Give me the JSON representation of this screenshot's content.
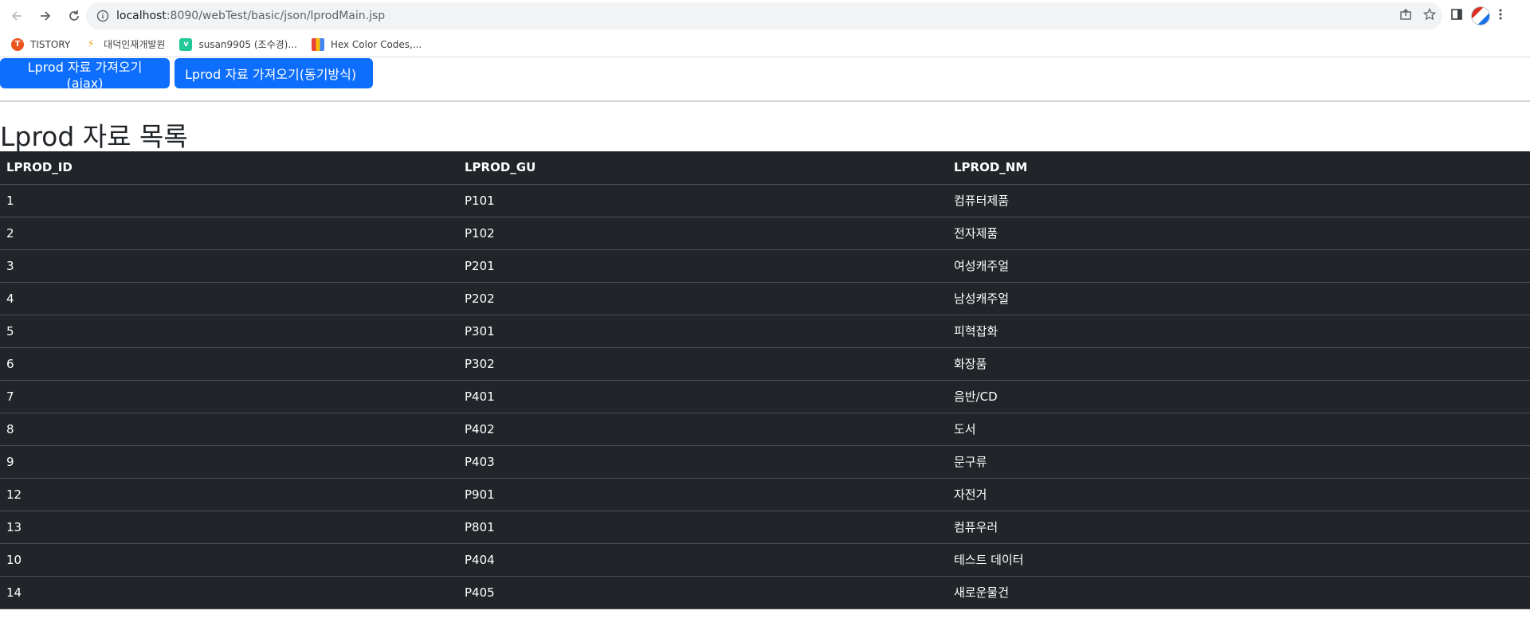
{
  "browser": {
    "url_host": "localhost",
    "url_rest": ":8090/webTest/basic/json/lprodMain.jsp",
    "bookmarks": [
      {
        "label": "TISTORY",
        "icon": "tistory-icon",
        "color": "#eb531f"
      },
      {
        "label": "대덕인재개발원",
        "icon": "ddit-icon",
        "color": "#f5a623"
      },
      {
        "label": "susan9905 (조수경)...",
        "icon": "velog-icon",
        "color": "#20c997"
      },
      {
        "label": "Hex Color Codes,...",
        "icon": "color-palette-icon",
        "color": "#4285f4"
      }
    ]
  },
  "page": {
    "buttons": {
      "ajax": "Lprod 자료 가져오기(ajax)",
      "sync": "Lprod 자료 가져오기(동기방식)"
    },
    "title": "Lprod 자료 목록",
    "table": {
      "headers": [
        "LPROD_ID",
        "LPROD_GU",
        "LPROD_NM"
      ],
      "rows": [
        [
          "1",
          "P101",
          "컴퓨터제품"
        ],
        [
          "2",
          "P102",
          "전자제품"
        ],
        [
          "3",
          "P201",
          "여성캐주얼"
        ],
        [
          "4",
          "P202",
          "남성캐주얼"
        ],
        [
          "5",
          "P301",
          "피혁잡화"
        ],
        [
          "6",
          "P302",
          "화장품"
        ],
        [
          "7",
          "P401",
          "음반/CD"
        ],
        [
          "8",
          "P402",
          "도서"
        ],
        [
          "9",
          "P403",
          "문구류"
        ],
        [
          "12",
          "P901",
          "자전거"
        ],
        [
          "13",
          "P801",
          "컴퓨우러"
        ],
        [
          "10",
          "P404",
          "테스트 데이터"
        ],
        [
          "14",
          "P405",
          "새로운물건"
        ]
      ]
    }
  },
  "colors": {
    "primary": "#0d6efd",
    "table_bg": "#212529"
  }
}
